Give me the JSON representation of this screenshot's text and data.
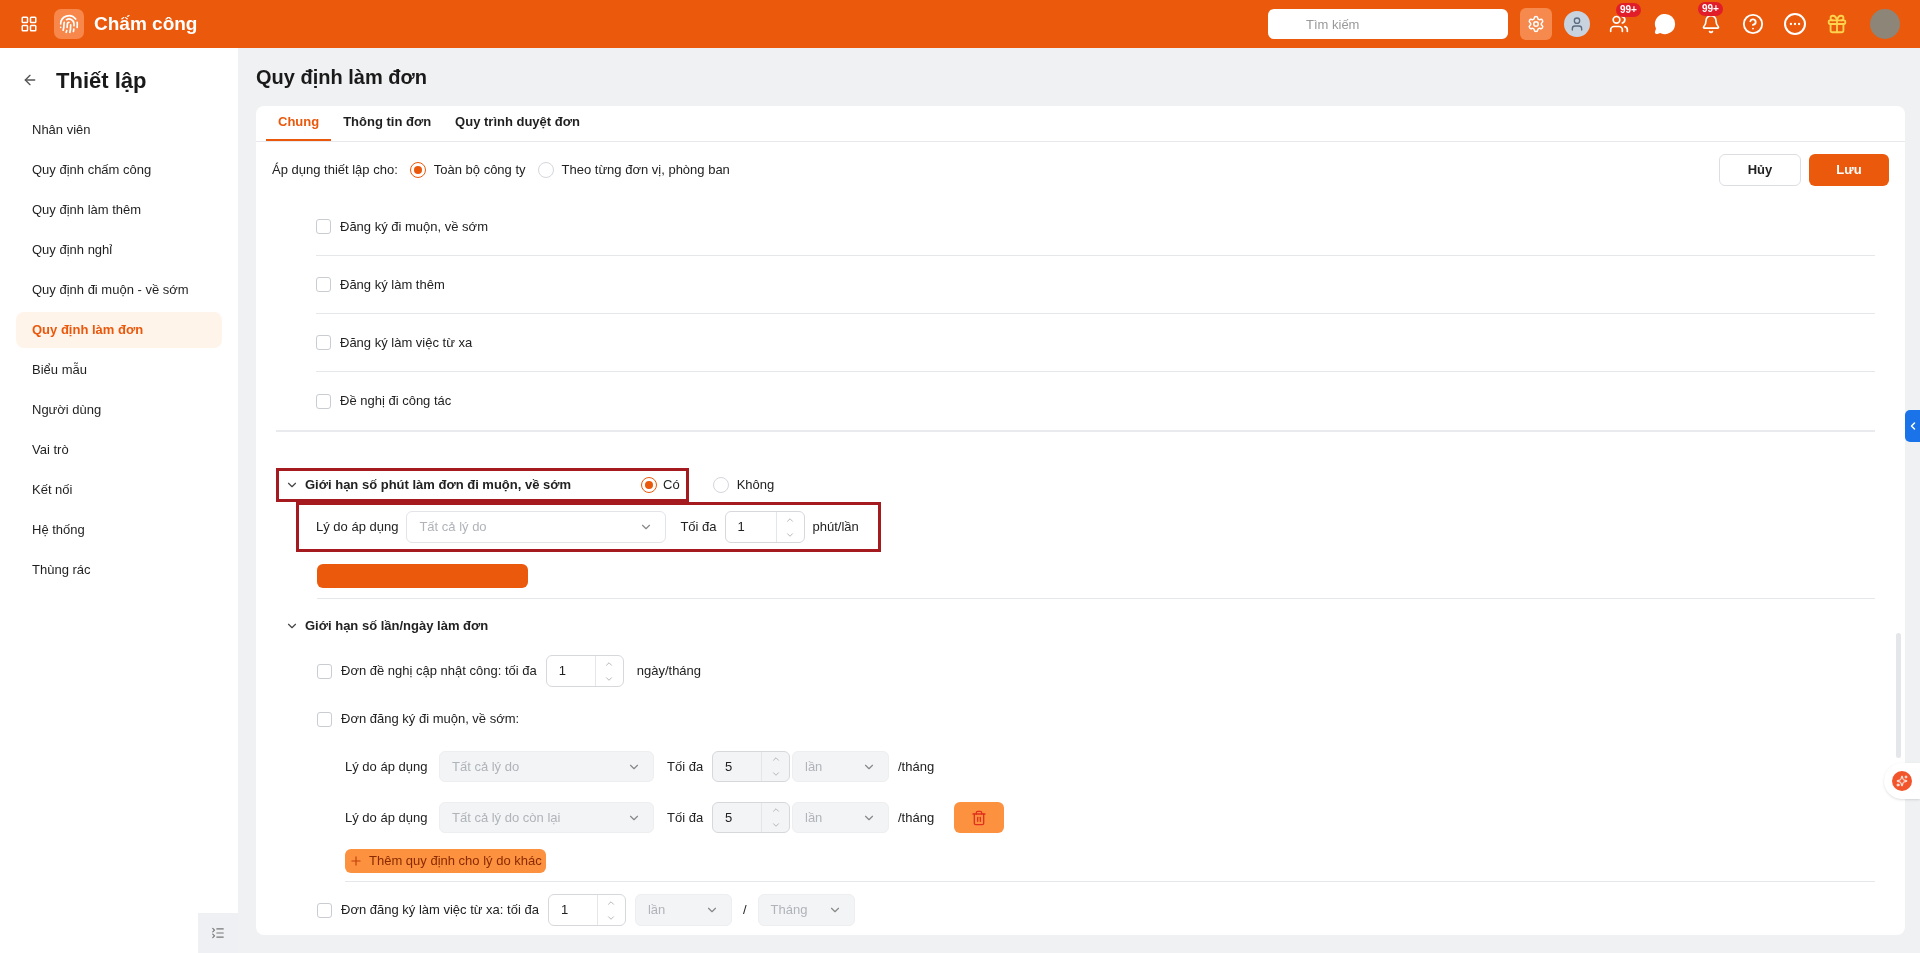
{
  "topbar": {
    "app_title": "Chấm công",
    "search": {
      "placeholder": "Tìm kiếm"
    },
    "badges": [
      "99+",
      "99+"
    ]
  },
  "sidebar": {
    "title": "Thiết lập",
    "items": [
      {
        "label": "Nhân viên",
        "selected": false
      },
      {
        "label": "Quy định chấm công",
        "selected": false
      },
      {
        "label": "Quy định làm thêm",
        "selected": false
      },
      {
        "label": "Quy định nghỉ",
        "selected": false
      },
      {
        "label": "Quy định đi muộn - về sớm",
        "selected": false
      },
      {
        "label": "Quy định làm đơn",
        "selected": true
      },
      {
        "label": "Biểu mẫu",
        "selected": false
      },
      {
        "label": "Người dùng",
        "selected": false
      },
      {
        "label": "Vai trò",
        "selected": false
      },
      {
        "label": "Kết nối",
        "selected": false
      },
      {
        "label": "Hệ thống",
        "selected": false
      },
      {
        "label": "Thùng rác",
        "selected": false
      }
    ]
  },
  "page_title": "Quy định làm đơn",
  "tabs": [
    {
      "label": "Chung",
      "selected": true
    },
    {
      "label": "Thông tin đơn",
      "selected": false
    },
    {
      "label": "Quy trình duyệt đơn",
      "selected": false
    }
  ],
  "apply": {
    "label": "Áp dụng thiết lập cho:",
    "options": [
      {
        "label": "Toàn bộ công ty",
        "selected": true
      },
      {
        "label": "Theo từng đơn vị, phòng ban",
        "selected": false
      }
    ]
  },
  "buttons": {
    "cancel": "Hủy",
    "save": "Lưu"
  },
  "form_types": [
    {
      "label": "Đăng ký đi muộn, về sớm",
      "checked": false
    },
    {
      "label": "Đăng ký làm thêm",
      "checked": false
    },
    {
      "label": "Đăng ký làm việc từ xa",
      "checked": false
    },
    {
      "label": "Đề nghị đi công tác",
      "checked": false
    }
  ],
  "minute_limit": {
    "title": "Giới hạn số phút làm đơn đi muộn, về sớm",
    "expanded": true,
    "highlighted": true,
    "options": [
      {
        "label": "Có",
        "selected": true
      },
      {
        "label": "Không",
        "selected": false
      }
    ],
    "rule": {
      "label": "Lý do áp dụng",
      "placeholder": "Tất cả lý do",
      "max_label": "Tối đa",
      "value": "1",
      "unit": "phút/lần",
      "highlighted": true
    }
  },
  "count_limit": {
    "title": "Giới hạn số lần/ngày làm đơn",
    "expanded": true,
    "items": [
      {
        "kind": "number",
        "label": "Đơn đề nghị cập nhật công: tối đa",
        "checked": false,
        "value": "1",
        "unit": "ngày/tháng"
      },
      {
        "kind": "reasons",
        "label": "Đơn đăng ký đi muộn, về sớm:",
        "checked": false,
        "rules": [
          {
            "label": "Lý do áp dụng",
            "reason": "Tất cả lý do",
            "max_label": "Tối đa",
            "value": "5",
            "unit": "lần",
            "period": "/tháng",
            "deletable": false
          },
          {
            "label": "Lý do áp dụng",
            "reason": "Tất cả lý do còn lại",
            "max_label": "Tối đa",
            "value": "5",
            "unit": "lần",
            "period": "/tháng",
            "deletable": true
          }
        ],
        "add_label": "Thêm quy định cho lý do khác"
      },
      {
        "kind": "number_select",
        "label": "Đơn đăng ký làm việc từ xa: tối đa",
        "checked": false,
        "value": "1",
        "unit": "lần",
        "separator": "/",
        "period": "Tháng"
      }
    ]
  }
}
